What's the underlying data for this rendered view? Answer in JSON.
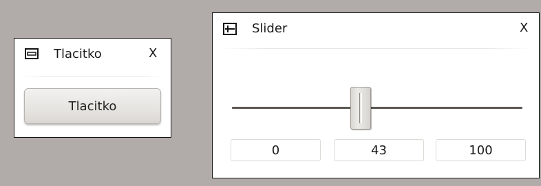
{
  "windows": {
    "button_window": {
      "title": "Tlacitko",
      "close_label": "X",
      "icon": "button-icon",
      "button_label": "Tlacitko"
    },
    "slider_window": {
      "title": "Slider",
      "close_label": "X",
      "icon": "slider-icon",
      "min_value": "0",
      "current_value": "43",
      "max_value": "100",
      "position_fraction": 0.43
    }
  },
  "colors": {
    "desktop_background": "#b1acaa",
    "window_background": "#ffffff",
    "window_border": "#111111",
    "track": "#5b5753"
  }
}
